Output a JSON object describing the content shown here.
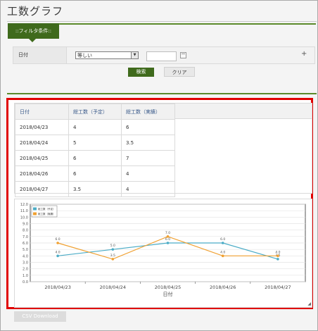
{
  "page": {
    "title": "工数グラフ"
  },
  "filter": {
    "tab_label": "::フィルタ条件::",
    "field_label": "日付",
    "operator_value": "等しい",
    "date_value": "",
    "search_label": "検索",
    "clear_label": "クリア"
  },
  "table": {
    "headers": [
      "日付",
      "総工数（予定）",
      "総工数（実績）"
    ],
    "rows": [
      [
        "2018/04/23",
        "4",
        "6"
      ],
      [
        "2018/04/24",
        "5",
        "3.5"
      ],
      [
        "2018/04/25",
        "6",
        "7"
      ],
      [
        "2018/04/26",
        "6",
        "4"
      ],
      [
        "2018/04/27",
        "3.5",
        "4"
      ]
    ]
  },
  "chart_data": {
    "type": "line",
    "categories": [
      "2018/04/23",
      "2018/04/24",
      "2018/04/25",
      "2018/04/26",
      "2018/04/27"
    ],
    "series": [
      {
        "name": "総工数（予定）",
        "values": [
          4.0,
          5.0,
          6.0,
          6.0,
          3.5
        ],
        "color": "#4bacc6"
      },
      {
        "name": "総工数（実績）",
        "values": [
          6.0,
          3.5,
          7.0,
          4.0,
          4.0
        ],
        "color": "#f0a030"
      }
    ],
    "data_labels": [
      [
        "4.0",
        "5.0",
        "6.0",
        "6.0",
        "3.5"
      ],
      [
        "6.0",
        "3.5",
        "7.0",
        "4.0",
        "4.0"
      ]
    ],
    "yticks": [
      "0.0",
      "1.0",
      "2.0",
      "3.0",
      "4.0",
      "5.0",
      "6.0",
      "7.0",
      "8.0",
      "9.0",
      "10.0",
      "11.0",
      "12.0"
    ],
    "xlabel": "日付",
    "ylim": [
      0,
      12
    ],
    "grid": true,
    "legend_position": "top-left"
  },
  "footer": {
    "csv_label": "CSV Download"
  },
  "icons": {
    "calendar": "calendar-icon",
    "add": "plus-icon",
    "resize": "resize-handle-icon"
  }
}
